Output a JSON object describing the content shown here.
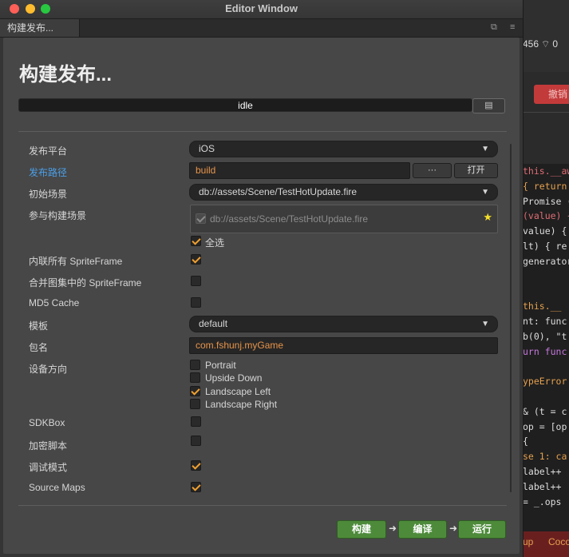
{
  "window": {
    "title": "Editor Window",
    "tab_label": "构建发布..."
  },
  "panel": {
    "heading": "构建发布...",
    "status": "idle",
    "fields": {
      "platform": {
        "label": "发布平台",
        "value": "iOS"
      },
      "build_path": {
        "label": "发布路径",
        "value": "build",
        "browse_label": "···",
        "open_label": "打开"
      },
      "start_scene": {
        "label": "初始场景",
        "value": "db://assets/Scene/TestHotUpdate.fire"
      },
      "included_scenes": {
        "label": "参与构建场景",
        "scene_path": "db://assets/Scene/TestHotUpdate.fire",
        "select_all_label": "全选",
        "select_all_checked": true
      },
      "inline_spriteframes": {
        "label": "内联所有 SpriteFrame",
        "checked": true
      },
      "merge_atlas": {
        "label": "合并图集中的 SpriteFrame",
        "checked": false
      },
      "md5_cache": {
        "label": "MD5 Cache",
        "checked": false
      },
      "template": {
        "label": "模板",
        "value": "default"
      },
      "package_name": {
        "label": "包名",
        "value": "com.fshunj.myGame"
      },
      "orientation": {
        "label": "设备方向",
        "options": [
          {
            "label": "Portrait",
            "checked": false
          },
          {
            "label": "Upside Down",
            "checked": false
          },
          {
            "label": "Landscape Left",
            "checked": true
          },
          {
            "label": "Landscape Right",
            "checked": false
          }
        ]
      },
      "sdkbox": {
        "label": "SDKBox",
        "checked": false
      },
      "encrypt_js": {
        "label": "加密脚本",
        "checked": false
      },
      "debug_mode": {
        "label": "调试模式",
        "checked": true
      },
      "source_maps": {
        "label": "Source Maps",
        "checked": true
      }
    },
    "actions": {
      "build_label": "构建",
      "compile_label": "编译",
      "run_label": "运行"
    }
  },
  "background_app": {
    "status_text": "456",
    "status_tail": "0",
    "red_button_label": "撤销",
    "code_lines": [
      [
        "this.__aw"
      ],
      [
        "{ return"
      ],
      [
        "Promise ("
      ],
      [
        "(value) {"
      ],
      [
        "value) {"
      ],
      [
        "lt) { re"
      ],
      [
        "generator"
      ],
      [
        ""
      ],
      [
        ""
      ],
      [
        "this.__"
      ],
      [
        "nt: func"
      ],
      [
        "b(0), \"t"
      ],
      [
        "urn func"
      ],
      [
        ""
      ],
      [
        "ypeError"
      ],
      [
        ""
      ],
      [
        "& (t = c"
      ],
      [
        "op = [op"
      ],
      [
        "{"
      ],
      [
        "se 1: ca"
      ],
      [
        "label++"
      ],
      [
        "label++"
      ],
      [
        "= _.ops"
      ]
    ],
    "bottom_tabs": [
      "up",
      "Coco"
    ]
  },
  "colors": {
    "accent": "#f0a030",
    "link": "#4a9fe8",
    "action_green": "#4d8b3a",
    "star": "#f6e02a"
  }
}
